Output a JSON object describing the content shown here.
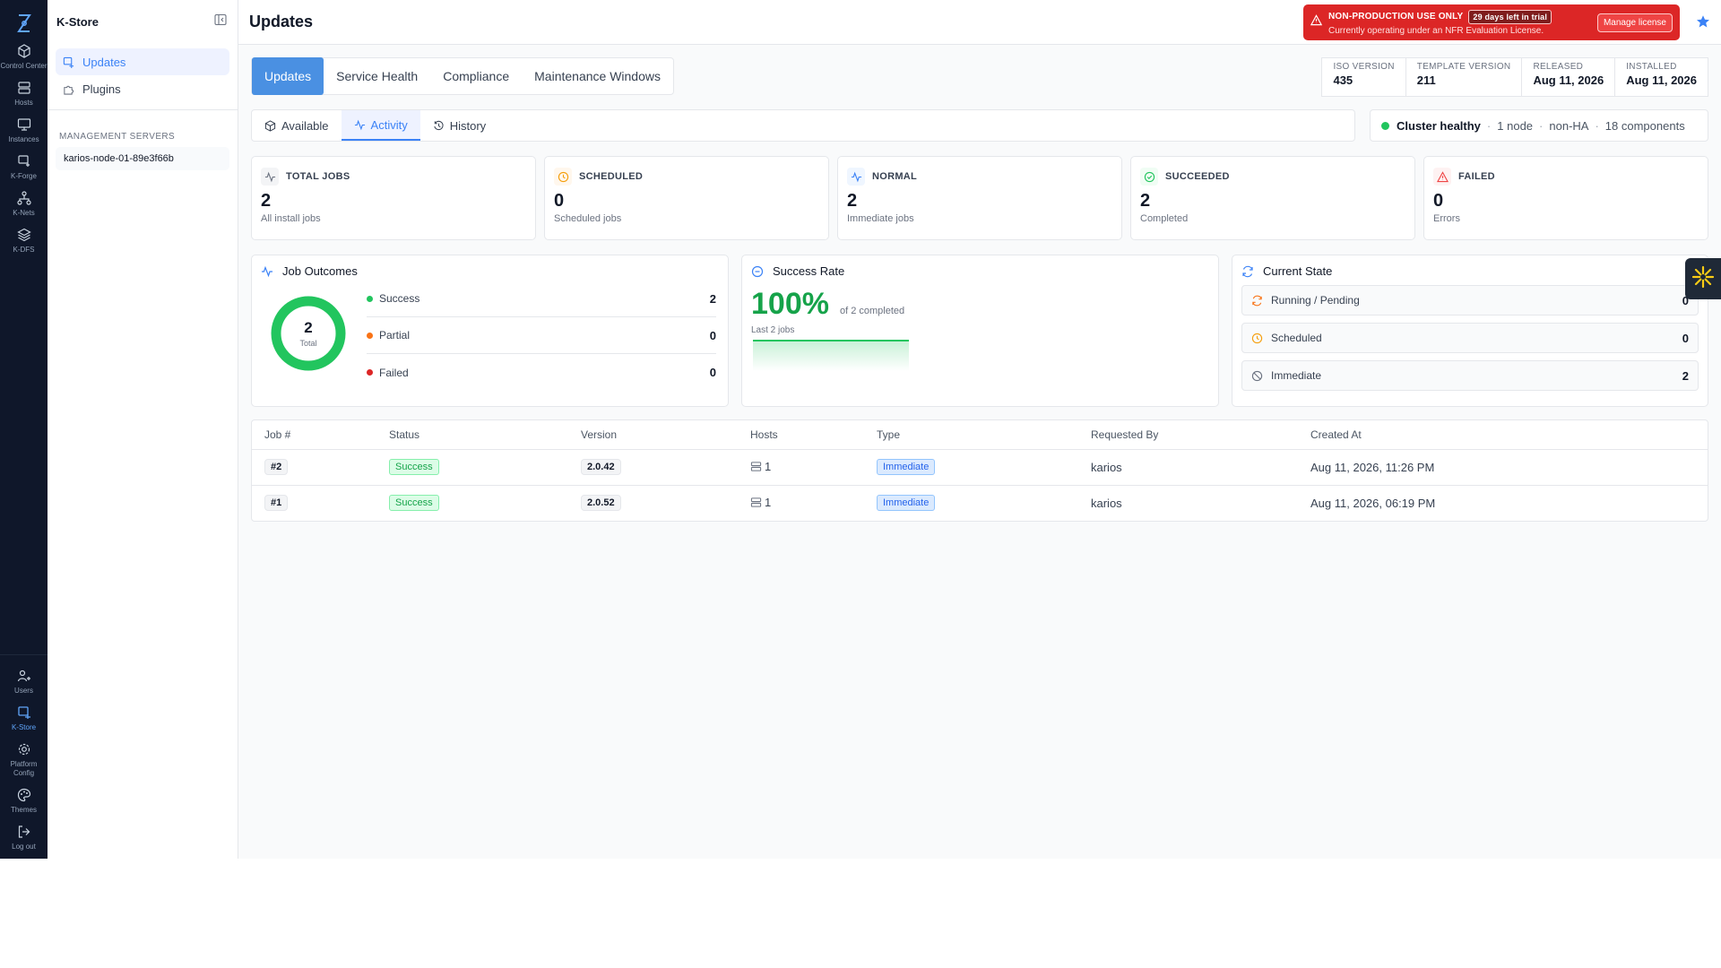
{
  "app": {
    "name": "K-Store"
  },
  "rail": {
    "items": [
      {
        "label": "Control Center",
        "icon": "cube-icon"
      },
      {
        "label": "Hosts",
        "icon": "server-icon"
      },
      {
        "label": "Instances",
        "icon": "monitor-icon"
      },
      {
        "label": "K-Forge",
        "icon": "forge-icon"
      },
      {
        "label": "K-Nets",
        "icon": "network-icon"
      },
      {
        "label": "K-DFS",
        "icon": "layers-icon"
      }
    ],
    "bottom": [
      {
        "label": "Users",
        "icon": "users-icon"
      },
      {
        "label": "K-Store",
        "icon": "store-icon"
      },
      {
        "label": "Platform Config",
        "icon": "gear-icon"
      },
      {
        "label": "Themes",
        "icon": "palette-icon"
      },
      {
        "label": "Log out",
        "icon": "logout-icon"
      }
    ]
  },
  "sidebar": {
    "title": "K-Store",
    "items": [
      {
        "label": "Updates"
      },
      {
        "label": "Plugins"
      }
    ],
    "section_label": "MANAGEMENT SERVERS",
    "server": "karios-node-01-89e3f66b"
  },
  "header": {
    "title": "Updates",
    "banner": {
      "title": "NON-PRODUCTION USE ONLY",
      "badge": "29 days left in trial",
      "message": "Currently operating under an NFR Evaluation License.",
      "button": "Manage license"
    }
  },
  "tabs": [
    "Updates",
    "Service Health",
    "Compliance",
    "Maintenance Windows"
  ],
  "versions": [
    {
      "key": "ISO VERSION",
      "value": "435"
    },
    {
      "key": "TEMPLATE VERSION",
      "value": "211"
    },
    {
      "key": "RELEASED",
      "value": "Aug 11, 2026"
    },
    {
      "key": "INSTALLED",
      "value": "Aug 11, 2026"
    }
  ],
  "subtabs": [
    "Available",
    "Activity",
    "History"
  ],
  "cluster": {
    "status": "Cluster healthy",
    "nodes": "1 node",
    "ha": "non-HA",
    "components": "18 components"
  },
  "stats": [
    {
      "label": "TOTAL JOBS",
      "value": "2",
      "sub": "All install jobs"
    },
    {
      "label": "SCHEDULED",
      "value": "0",
      "sub": "Scheduled jobs"
    },
    {
      "label": "NORMAL",
      "value": "2",
      "sub": "Immediate jobs"
    },
    {
      "label": "SUCCEEDED",
      "value": "2",
      "sub": "Completed"
    },
    {
      "label": "FAILED",
      "value": "0",
      "sub": "Errors"
    }
  ],
  "outcomes": {
    "title": "Job Outcomes",
    "total": "2",
    "total_label": "Total",
    "rows": [
      {
        "label": "Success",
        "count": "2",
        "color": "#22c55e"
      },
      {
        "label": "Partial",
        "count": "0",
        "color": "#f97316"
      },
      {
        "label": "Failed",
        "count": "0",
        "color": "#dc2626"
      }
    ]
  },
  "success_rate": {
    "title": "Success Rate",
    "value": "100%",
    "of": "of 2 completed",
    "window": "Last 2 jobs"
  },
  "current_state": {
    "title": "Current State",
    "rows": [
      {
        "label": "Running / Pending",
        "count": "0"
      },
      {
        "label": "Scheduled",
        "count": "0"
      },
      {
        "label": "Immediate",
        "count": "2"
      }
    ]
  },
  "jobs": {
    "columns": [
      "Job #",
      "Status",
      "Version",
      "Hosts",
      "Type",
      "Requested By",
      "Created At"
    ],
    "rows": [
      {
        "job": "#2",
        "status": "Success",
        "version": "2.0.42",
        "hosts": "1",
        "type": "Immediate",
        "requested_by": "karios",
        "created_at": "Aug 11, 2026, 11:26 PM"
      },
      {
        "job": "#1",
        "status": "Success",
        "version": "2.0.52",
        "hosts": "1",
        "type": "Immediate",
        "requested_by": "karios",
        "created_at": "Aug 11, 2026, 06:19 PM"
      }
    ]
  },
  "colors": {
    "accent": "#4a90e2",
    "success": "#22c55e",
    "danger": "#dc2626",
    "rail": "#0f172a"
  }
}
